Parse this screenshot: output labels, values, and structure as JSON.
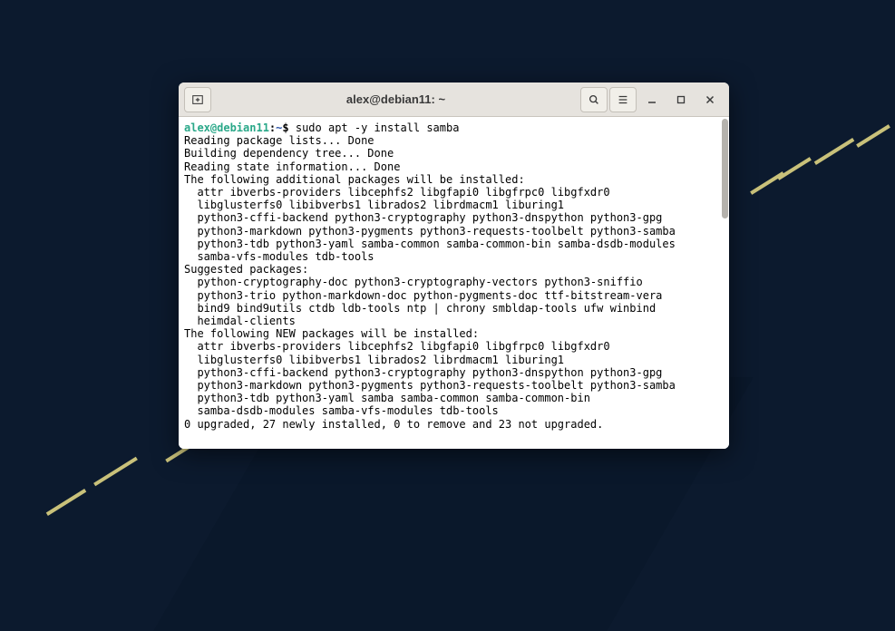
{
  "window": {
    "title": "alex@debian11: ~"
  },
  "prompt": {
    "userhost": "alex@debian11",
    "sep": ":",
    "path": "~",
    "dollar": "$ ",
    "command": "sudo apt -y install samba"
  },
  "output": [
    "Reading package lists... Done",
    "Building dependency tree... Done",
    "Reading state information... Done",
    "The following additional packages will be installed:",
    "  attr ibverbs-providers libcephfs2 libgfapi0 libgfrpc0 libgfxdr0",
    "  libglusterfs0 libibverbs1 librados2 librdmacm1 liburing1",
    "  python3-cffi-backend python3-cryptography python3-dnspython python3-gpg",
    "  python3-markdown python3-pygments python3-requests-toolbelt python3-samba",
    "  python3-tdb python3-yaml samba-common samba-common-bin samba-dsdb-modules",
    "  samba-vfs-modules tdb-tools",
    "Suggested packages:",
    "  python-cryptography-doc python3-cryptography-vectors python3-sniffio",
    "  python3-trio python-markdown-doc python-pygments-doc ttf-bitstream-vera",
    "  bind9 bind9utils ctdb ldb-tools ntp | chrony smbldap-tools ufw winbind",
    "  heimdal-clients",
    "The following NEW packages will be installed:",
    "  attr ibverbs-providers libcephfs2 libgfapi0 libgfrpc0 libgfxdr0",
    "  libglusterfs0 libibverbs1 librados2 librdmacm1 liburing1",
    "  python3-cffi-backend python3-cryptography python3-dnspython python3-gpg",
    "  python3-markdown python3-pygments python3-requests-toolbelt python3-samba",
    "  python3-tdb python3-yaml samba samba-common samba-common-bin",
    "  samba-dsdb-modules samba-vfs-modules tdb-tools",
    "0 upgraded, 27 newly installed, 0 to remove and 23 not upgraded."
  ]
}
